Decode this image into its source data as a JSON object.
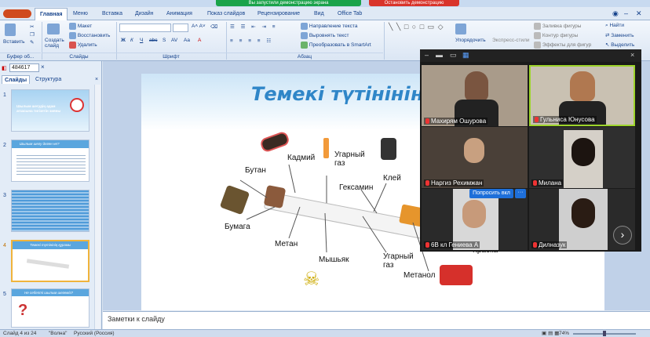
{
  "titlebar": {
    "share_start": "Вы запустили демонстрацию экрана",
    "share_stop": "Остановить демонстрацию"
  },
  "tabs": [
    "Главная",
    "Меню",
    "Вставка",
    "Дизайн",
    "Анимация",
    "Показ слайдов",
    "Рецензирование",
    "Вид",
    "Office Tab"
  ],
  "ribbon": {
    "paste": "Вставить",
    "create_slide": "Создать слайд",
    "layout": "Макет",
    "restore": "Восстановить",
    "delete": "Удалить",
    "text_direction": "Направление текста",
    "align_text": "Выровнять текст",
    "smartart": "Преобразовать в SmartArt",
    "arrange": "Упорядочить",
    "quick_styles": "Экспресс-стили",
    "shape_fill": "Заливка фигуры",
    "shape_outline": "Контур фигуры",
    "shape_effects": "Эффекты для фигур",
    "find": "Найти",
    "replace": "Заменить",
    "select": "Выделить",
    "groups": {
      "clipboard": "Буфер об...",
      "slides": "Слайды",
      "font": "Шрифт",
      "paragraph": "Абзац"
    }
  },
  "doc_tab": "484617",
  "panel_tabs": {
    "slides": "Слайды",
    "outline": "Структура"
  },
  "thumbs": [
    {
      "num": "1",
      "title": "Шылым шегудің адам ағзасына тигізетін зияны"
    },
    {
      "num": "2",
      "title": "Шылым шегу деген не?"
    },
    {
      "num": "3",
      "title": ""
    },
    {
      "num": "4",
      "title": "Темекі түтінінің құрамы"
    },
    {
      "num": "5",
      "title": "Не себепті шылым шегеміз?"
    }
  ],
  "slide": {
    "title": "Темекі түтінінің құ",
    "labels": {
      "butan": "Бутан",
      "kadmiy": "Кадмий",
      "ugarny1": "Угарный газ",
      "klei": "Клей",
      "bumaga": "Бумага",
      "geksamin": "Гексамин",
      "metan": "Метан",
      "myshyak": "Мышьяк",
      "ugarny2": "Угарный газ",
      "metanol": "Метанол",
      "kraska": "Краска"
    }
  },
  "notes_placeholder": "Заметки к слайду",
  "status": {
    "slide": "Слайд 4 из 24",
    "theme": "\"Волна\"",
    "lang": "Русский (Россия)",
    "zoom": "74%"
  },
  "video": {
    "participants": [
      {
        "name": "Махирям Ошурова",
        "muted": true
      },
      {
        "name": "Гульниса Юнусова",
        "muted": true
      },
      {
        "name": "Наргиз Рехимжан",
        "muted": true
      },
      {
        "name": "Милана",
        "muted": true
      },
      {
        "name": "6В кл Гениева А",
        "muted": true
      },
      {
        "name": "Дилназук",
        "muted": true
      }
    ],
    "ask_button": "Попросить вкл",
    "more_button": "···",
    "next": "›"
  },
  "colors": {
    "accent": "#2f86c8",
    "share_green": "#1aa34a",
    "share_red": "#d9342b"
  }
}
